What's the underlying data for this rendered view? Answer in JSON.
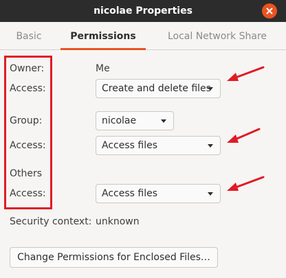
{
  "window": {
    "title": "nicolae Properties",
    "close_icon": "close-icon"
  },
  "tabs": [
    {
      "label": "Basic",
      "active": false
    },
    {
      "label": "Permissions",
      "active": true
    },
    {
      "label": "Local Network Share",
      "active": false
    }
  ],
  "permissions": {
    "owner_label": "Owner:",
    "owner_value": "Me",
    "owner_access_label": "Access:",
    "owner_access_value": "Create and delete files",
    "group_label": "Group:",
    "group_value": "nicolae",
    "group_access_label": "Access:",
    "group_access_value": "Access files",
    "others_label": "Others",
    "others_access_label": "Access:",
    "others_access_value": "Access files",
    "security_context_label": "Security context:",
    "security_context_value": "unknown",
    "enclosed_button_label": "Change Permissions for Enclosed Files…"
  },
  "annotations": {
    "highlight_color": "#e01b24",
    "arrow_icon": "red-arrow-icon"
  },
  "colors": {
    "accent": "#e95420",
    "titlebar": "#2c2c2c",
    "background": "#f6f5f4"
  }
}
